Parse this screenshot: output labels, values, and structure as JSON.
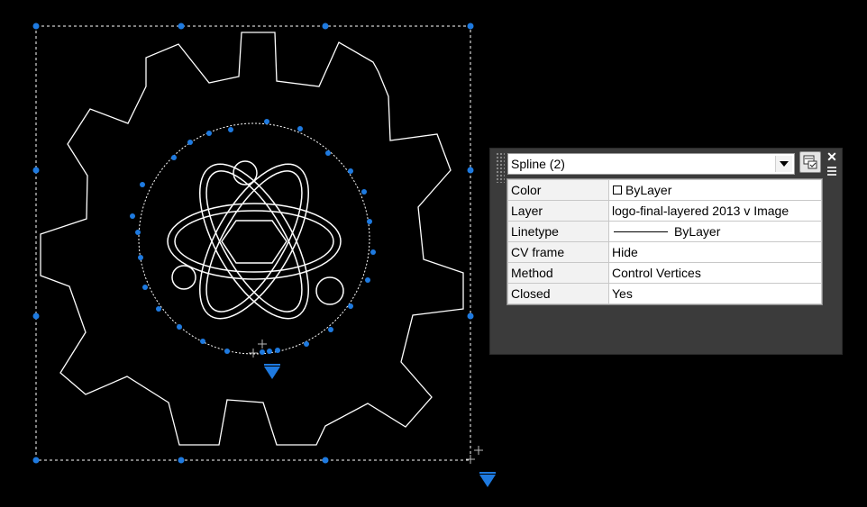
{
  "canvas": {
    "background": "#000000",
    "grip_color": "#1e7ae0",
    "object_color": "#ffffff",
    "selection_box_color": "#ffffff"
  },
  "properties": {
    "object_type": "Spline (2)",
    "rows": [
      {
        "key": "Color",
        "value": "ByLayer",
        "marker": "color-swatch"
      },
      {
        "key": "Layer",
        "value": "logo-final-layered 2013 v Image"
      },
      {
        "key": "Linetype",
        "value": "ByLayer",
        "marker": "linetype-line"
      },
      {
        "key": "CV frame",
        "value": "Hide"
      },
      {
        "key": "Method",
        "value": "Control Vertices"
      },
      {
        "key": "Closed",
        "value": "Yes"
      }
    ],
    "close_icon": "✕",
    "colors": {
      "panel": "#3b3b3b",
      "table": "#ffffff"
    }
  }
}
